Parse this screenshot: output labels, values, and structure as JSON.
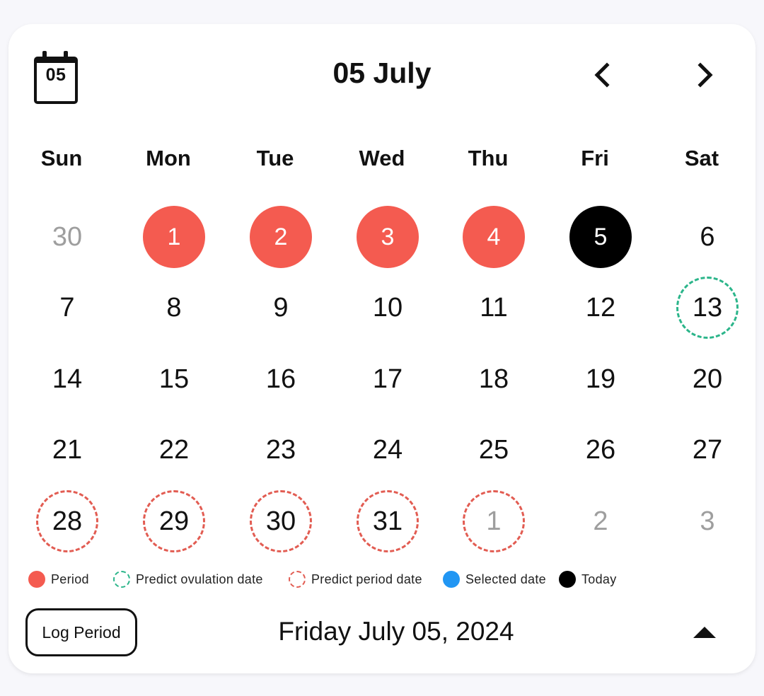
{
  "header": {
    "calendar_icon_day": "05",
    "title": "05 July",
    "prev_icon": "chevron-left-icon",
    "next_icon": "chevron-right-icon"
  },
  "weekdays": [
    "Sun",
    "Mon",
    "Tue",
    "Wed",
    "Thu",
    "Fri",
    "Sat"
  ],
  "weeks": [
    [
      {
        "label": "30",
        "state": "outside"
      },
      {
        "label": "1",
        "state": "period"
      },
      {
        "label": "2",
        "state": "period"
      },
      {
        "label": "3",
        "state": "period"
      },
      {
        "label": "4",
        "state": "period"
      },
      {
        "label": "5",
        "state": "today"
      },
      {
        "label": "6",
        "state": "normal"
      }
    ],
    [
      {
        "label": "7",
        "state": "normal"
      },
      {
        "label": "8",
        "state": "normal"
      },
      {
        "label": "9",
        "state": "normal"
      },
      {
        "label": "10",
        "state": "normal"
      },
      {
        "label": "11",
        "state": "normal"
      },
      {
        "label": "12",
        "state": "normal"
      },
      {
        "label": "13",
        "state": "ovulation"
      }
    ],
    [
      {
        "label": "14",
        "state": "normal"
      },
      {
        "label": "15",
        "state": "normal"
      },
      {
        "label": "16",
        "state": "normal"
      },
      {
        "label": "17",
        "state": "normal"
      },
      {
        "label": "18",
        "state": "normal"
      },
      {
        "label": "19",
        "state": "normal"
      },
      {
        "label": "20",
        "state": "normal"
      }
    ],
    [
      {
        "label": "21",
        "state": "normal"
      },
      {
        "label": "22",
        "state": "normal"
      },
      {
        "label": "23",
        "state": "normal"
      },
      {
        "label": "24",
        "state": "normal"
      },
      {
        "label": "25",
        "state": "normal"
      },
      {
        "label": "26",
        "state": "normal"
      },
      {
        "label": "27",
        "state": "normal"
      }
    ],
    [
      {
        "label": "28",
        "state": "predict"
      },
      {
        "label": "29",
        "state": "predict"
      },
      {
        "label": "30",
        "state": "predict"
      },
      {
        "label": "31",
        "state": "predict"
      },
      {
        "label": "1",
        "state": "predict-outside"
      },
      {
        "label": "2",
        "state": "outside"
      },
      {
        "label": "3",
        "state": "outside"
      }
    ]
  ],
  "legend": [
    {
      "label": "Period",
      "style": "filled",
      "color": "#f45b50"
    },
    {
      "label": "Predict ovulation date",
      "style": "dashed",
      "color": "#2bb58a"
    },
    {
      "label": "Predict period date",
      "style": "dashed",
      "color": "#e25c52"
    },
    {
      "label": "Selected date",
      "style": "filled",
      "color": "#2196f3"
    },
    {
      "label": "Today",
      "style": "filled",
      "color": "#000000"
    }
  ],
  "footer": {
    "log_button_label": "Log Period",
    "selected_date_text": "Friday July 05, 2024",
    "collapse_icon": "triangle-up-icon"
  },
  "colors": {
    "period": "#f45b50",
    "ovulation": "#2bb58a",
    "predict_period": "#e25c52",
    "selected": "#2196f3",
    "today": "#000000",
    "outside_text": "#9e9e9e"
  }
}
